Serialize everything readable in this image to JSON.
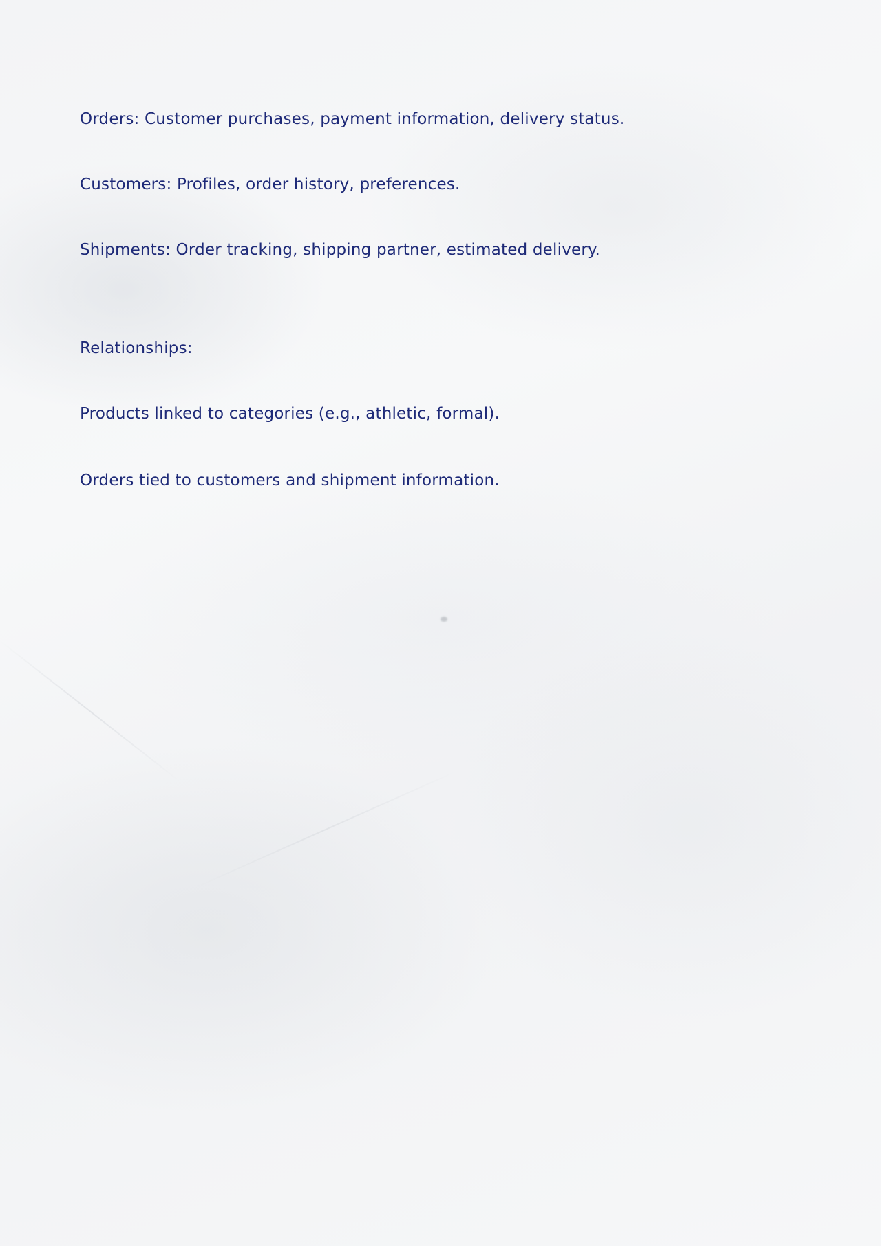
{
  "notes": {
    "lines": [
      "Orders: Customer purchases, payment information, delivery status.",
      "Customers: Profiles, order history, preferences.",
      "Shipments: Order tracking, shipping partner, estimated delivery.",
      "Relationships:",
      "Products linked to categories (e.g., athletic, formal).",
      "Orders tied to customers and shipment information."
    ],
    "ink_color": "#1e2a78"
  }
}
